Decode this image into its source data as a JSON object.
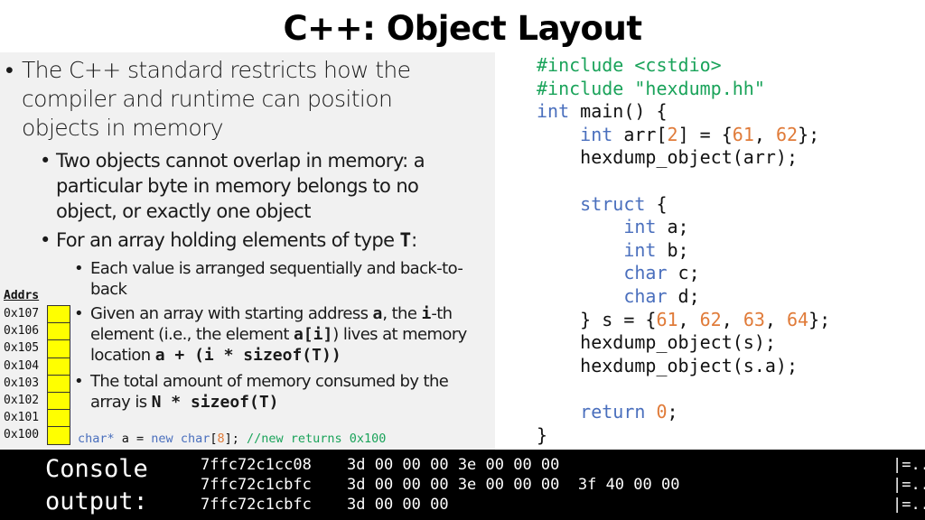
{
  "slide": {
    "title": "C++: Object Layout"
  },
  "bullets": {
    "main": "The C++ standard restricts how the compiler and runtime can position objects in memory",
    "sub1": "Two objects cannot overlap in memory: a particular byte in memory belongs to no object, or exactly one object",
    "sub2_prefix": "For an array holding elements of type ",
    "sub2_code": "T",
    "sub2_suffix": ":",
    "subsub1": "Each value is arranged sequentially and back-to-back",
    "subsub2": {
      "t1": "Given an array with starting address ",
      "c1": "a",
      "t2": ", the ",
      "c2": "i",
      "t3": "-th element (i.e., the element ",
      "c3": "a[i]",
      "t4": ") lives at memory location ",
      "c4": "a + (i * sizeof(T))"
    },
    "subsub3": {
      "t1": "The total amount of memory consumed by the array is ",
      "c1": "N * sizeof(T)"
    }
  },
  "memory_diagram": {
    "header": "Addrs",
    "addresses": [
      "0x107",
      "0x106",
      "0x105",
      "0x104",
      "0x103",
      "0x102",
      "0x101",
      "0x100"
    ],
    "cell_color": "#ffff00"
  },
  "alloc_code": {
    "type": "char*",
    "var": " a = ",
    "kw_new": "new",
    "space": " ",
    "kw_char": "char",
    "open": "[",
    "size": "8",
    "close": "]; ",
    "comment": "//new returns 0x100"
  },
  "code": {
    "lines": [
      [
        {
          "t": "#include <cstdio>",
          "c": "pp"
        }
      ],
      [
        {
          "t": "#include \"hexdump.hh\"",
          "c": "pp"
        }
      ],
      [
        {
          "t": "int",
          "c": "kw"
        },
        {
          "t": " main() {",
          "c": "plain"
        }
      ],
      [
        {
          "t": "    ",
          "c": "plain"
        },
        {
          "t": "int",
          "c": "kw"
        },
        {
          "t": " arr[",
          "c": "plain"
        },
        {
          "t": "2",
          "c": "num"
        },
        {
          "t": "] = {",
          "c": "plain"
        },
        {
          "t": "61",
          "c": "num"
        },
        {
          "t": ", ",
          "c": "plain"
        },
        {
          "t": "62",
          "c": "num"
        },
        {
          "t": "};",
          "c": "plain"
        }
      ],
      [
        {
          "t": "    hexdump_object(arr);",
          "c": "plain"
        }
      ],
      [
        {
          "t": "",
          "c": "plain"
        }
      ],
      [
        {
          "t": "    ",
          "c": "plain"
        },
        {
          "t": "struct",
          "c": "kw"
        },
        {
          "t": " {",
          "c": "plain"
        }
      ],
      [
        {
          "t": "        ",
          "c": "plain"
        },
        {
          "t": "int",
          "c": "kw"
        },
        {
          "t": " a;",
          "c": "plain"
        }
      ],
      [
        {
          "t": "        ",
          "c": "plain"
        },
        {
          "t": "int",
          "c": "kw"
        },
        {
          "t": " b;",
          "c": "plain"
        }
      ],
      [
        {
          "t": "        ",
          "c": "plain"
        },
        {
          "t": "char",
          "c": "kw"
        },
        {
          "t": " c;",
          "c": "plain"
        }
      ],
      [
        {
          "t": "        ",
          "c": "plain"
        },
        {
          "t": "char",
          "c": "kw"
        },
        {
          "t": " d;",
          "c": "plain"
        }
      ],
      [
        {
          "t": "    } s = {",
          "c": "plain"
        },
        {
          "t": "61",
          "c": "num"
        },
        {
          "t": ", ",
          "c": "plain"
        },
        {
          "t": "62",
          "c": "num"
        },
        {
          "t": ", ",
          "c": "plain"
        },
        {
          "t": "63",
          "c": "num"
        },
        {
          "t": ", ",
          "c": "plain"
        },
        {
          "t": "64",
          "c": "num"
        },
        {
          "t": "};",
          "c": "plain"
        }
      ],
      [
        {
          "t": "    hexdump_object(s);",
          "c": "plain"
        }
      ],
      [
        {
          "t": "    hexdump_object(s.a);",
          "c": "plain"
        }
      ],
      [
        {
          "t": "",
          "c": "plain"
        }
      ],
      [
        {
          "t": "    ",
          "c": "plain"
        },
        {
          "t": "return",
          "c": "kw"
        },
        {
          "t": " ",
          "c": "plain"
        },
        {
          "t": "0",
          "c": "num"
        },
        {
          "t": ";",
          "c": "plain"
        }
      ],
      [
        {
          "t": "}",
          "c": "plain"
        }
      ]
    ]
  },
  "console": {
    "label_line1": "Console",
    "label_line2": "output:",
    "lines": [
      {
        "addr": "7ffc72c1cc08",
        "bytes": "3d 00 00 00 3e 00 00 00",
        "ascii": "|=...>...|"
      },
      {
        "addr": "7ffc72c1cbfc",
        "bytes": "3d 00 00 00 3e 00 00 00  3f 40 00 00",
        "ascii": "|=...>...?@..|"
      },
      {
        "addr": "7ffc72c1cbfc",
        "bytes": "3d 00 00 00",
        "ascii": "|=...|"
      }
    ]
  },
  "colors": {
    "keyword": "#4a6fbd",
    "number": "#e07b39",
    "preprocessor": "#1aa35a",
    "panel_bg": "#f1f1f1",
    "console_bg": "#000000"
  }
}
